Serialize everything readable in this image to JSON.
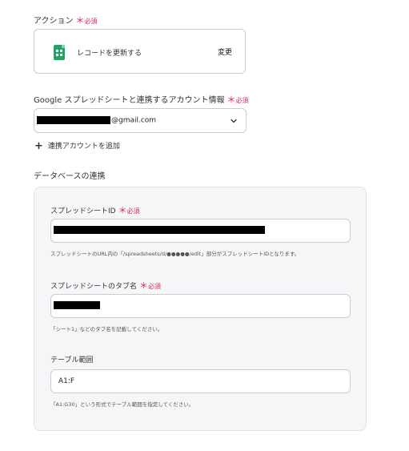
{
  "action": {
    "label": "アクション",
    "required_mark": "＊",
    "required_text": "必須",
    "name": "レコードを更新する",
    "change_label": "変更",
    "icon": "google-sheets-icon"
  },
  "account": {
    "label": "Google スプレッドシートと連携するアカウント情報",
    "required_mark": "＊",
    "required_text": "必須",
    "selected_value_visible": "@gmail.com",
    "add_label": "連携アカウントを追加"
  },
  "database": {
    "section_label": "データベースの連携",
    "spreadsheet_id": {
      "label": "スプレッドシートID",
      "required_mark": "＊",
      "required_text": "必須",
      "help": "スプレッドシートのURL内の「/spreadsheets/d/●●●●●/edit」部分がスプレッドシートIDとなります。"
    },
    "tab_name": {
      "label": "スプレッドシートのタブ名",
      "required_mark": "＊",
      "required_text": "必須",
      "help": "「シート1」などのタブ名を記載してください。"
    },
    "table_range": {
      "label": "テーブル範囲",
      "value": "A1:F",
      "help": "「A1:G30」という形式でテーブル範囲を指定してください。"
    }
  },
  "colors": {
    "required": "#e0245e",
    "sheets_green": "#1fa463",
    "panel_bg": "#f5f6f8",
    "border": "#c9cdd3"
  }
}
